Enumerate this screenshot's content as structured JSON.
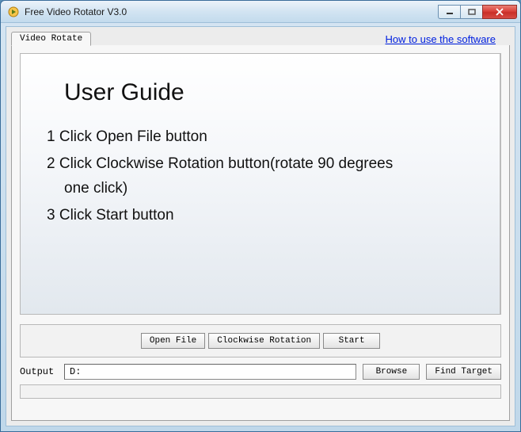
{
  "window": {
    "title": "Free Video Rotator V3.0"
  },
  "tabs": {
    "active_label": "Video Rotate"
  },
  "help_link": "How to use the software",
  "guide": {
    "title": "User Guide",
    "step1": "1 Click Open File button",
    "step2_line1": "2 Click Clockwise Rotation button(rotate 90 degrees",
    "step2_line2": "one click)",
    "step3": "3 Click Start button"
  },
  "buttons": {
    "open_file": "Open File",
    "clockwise": "Clockwise Rotation",
    "start": "Start",
    "browse": "Browse",
    "find_target": "Find Target"
  },
  "output": {
    "label": "Output",
    "value": "D:"
  }
}
